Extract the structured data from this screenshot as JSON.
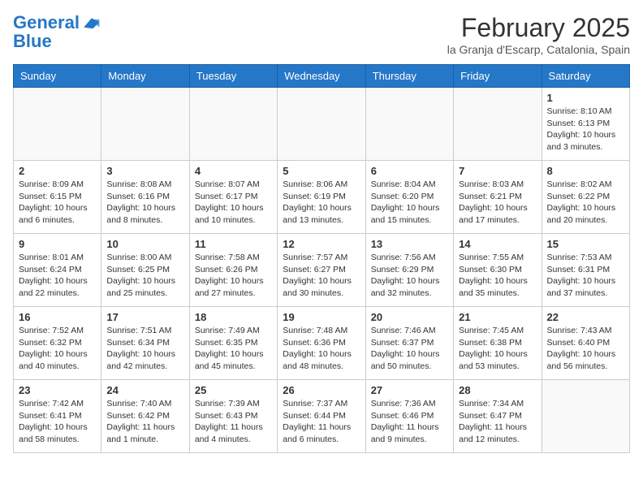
{
  "header": {
    "logo_line1": "General",
    "logo_line2": "Blue",
    "month": "February 2025",
    "location": "la Granja d'Escarp, Catalonia, Spain"
  },
  "days_of_week": [
    "Sunday",
    "Monday",
    "Tuesday",
    "Wednesday",
    "Thursday",
    "Friday",
    "Saturday"
  ],
  "weeks": [
    [
      {
        "day": "",
        "info": ""
      },
      {
        "day": "",
        "info": ""
      },
      {
        "day": "",
        "info": ""
      },
      {
        "day": "",
        "info": ""
      },
      {
        "day": "",
        "info": ""
      },
      {
        "day": "",
        "info": ""
      },
      {
        "day": "1",
        "info": "Sunrise: 8:10 AM\nSunset: 6:13 PM\nDaylight: 10 hours and 3 minutes."
      }
    ],
    [
      {
        "day": "2",
        "info": "Sunrise: 8:09 AM\nSunset: 6:15 PM\nDaylight: 10 hours and 6 minutes."
      },
      {
        "day": "3",
        "info": "Sunrise: 8:08 AM\nSunset: 6:16 PM\nDaylight: 10 hours and 8 minutes."
      },
      {
        "day": "4",
        "info": "Sunrise: 8:07 AM\nSunset: 6:17 PM\nDaylight: 10 hours and 10 minutes."
      },
      {
        "day": "5",
        "info": "Sunrise: 8:06 AM\nSunset: 6:19 PM\nDaylight: 10 hours and 13 minutes."
      },
      {
        "day": "6",
        "info": "Sunrise: 8:04 AM\nSunset: 6:20 PM\nDaylight: 10 hours and 15 minutes."
      },
      {
        "day": "7",
        "info": "Sunrise: 8:03 AM\nSunset: 6:21 PM\nDaylight: 10 hours and 17 minutes."
      },
      {
        "day": "8",
        "info": "Sunrise: 8:02 AM\nSunset: 6:22 PM\nDaylight: 10 hours and 20 minutes."
      }
    ],
    [
      {
        "day": "9",
        "info": "Sunrise: 8:01 AM\nSunset: 6:24 PM\nDaylight: 10 hours and 22 minutes."
      },
      {
        "day": "10",
        "info": "Sunrise: 8:00 AM\nSunset: 6:25 PM\nDaylight: 10 hours and 25 minutes."
      },
      {
        "day": "11",
        "info": "Sunrise: 7:58 AM\nSunset: 6:26 PM\nDaylight: 10 hours and 27 minutes."
      },
      {
        "day": "12",
        "info": "Sunrise: 7:57 AM\nSunset: 6:27 PM\nDaylight: 10 hours and 30 minutes."
      },
      {
        "day": "13",
        "info": "Sunrise: 7:56 AM\nSunset: 6:29 PM\nDaylight: 10 hours and 32 minutes."
      },
      {
        "day": "14",
        "info": "Sunrise: 7:55 AM\nSunset: 6:30 PM\nDaylight: 10 hours and 35 minutes."
      },
      {
        "day": "15",
        "info": "Sunrise: 7:53 AM\nSunset: 6:31 PM\nDaylight: 10 hours and 37 minutes."
      }
    ],
    [
      {
        "day": "16",
        "info": "Sunrise: 7:52 AM\nSunset: 6:32 PM\nDaylight: 10 hours and 40 minutes."
      },
      {
        "day": "17",
        "info": "Sunrise: 7:51 AM\nSunset: 6:34 PM\nDaylight: 10 hours and 42 minutes."
      },
      {
        "day": "18",
        "info": "Sunrise: 7:49 AM\nSunset: 6:35 PM\nDaylight: 10 hours and 45 minutes."
      },
      {
        "day": "19",
        "info": "Sunrise: 7:48 AM\nSunset: 6:36 PM\nDaylight: 10 hours and 48 minutes."
      },
      {
        "day": "20",
        "info": "Sunrise: 7:46 AM\nSunset: 6:37 PM\nDaylight: 10 hours and 50 minutes."
      },
      {
        "day": "21",
        "info": "Sunrise: 7:45 AM\nSunset: 6:38 PM\nDaylight: 10 hours and 53 minutes."
      },
      {
        "day": "22",
        "info": "Sunrise: 7:43 AM\nSunset: 6:40 PM\nDaylight: 10 hours and 56 minutes."
      }
    ],
    [
      {
        "day": "23",
        "info": "Sunrise: 7:42 AM\nSunset: 6:41 PM\nDaylight: 10 hours and 58 minutes."
      },
      {
        "day": "24",
        "info": "Sunrise: 7:40 AM\nSunset: 6:42 PM\nDaylight: 11 hours and 1 minute."
      },
      {
        "day": "25",
        "info": "Sunrise: 7:39 AM\nSunset: 6:43 PM\nDaylight: 11 hours and 4 minutes."
      },
      {
        "day": "26",
        "info": "Sunrise: 7:37 AM\nSunset: 6:44 PM\nDaylight: 11 hours and 6 minutes."
      },
      {
        "day": "27",
        "info": "Sunrise: 7:36 AM\nSunset: 6:46 PM\nDaylight: 11 hours and 9 minutes."
      },
      {
        "day": "28",
        "info": "Sunrise: 7:34 AM\nSunset: 6:47 PM\nDaylight: 11 hours and 12 minutes."
      },
      {
        "day": "",
        "info": ""
      }
    ]
  ]
}
